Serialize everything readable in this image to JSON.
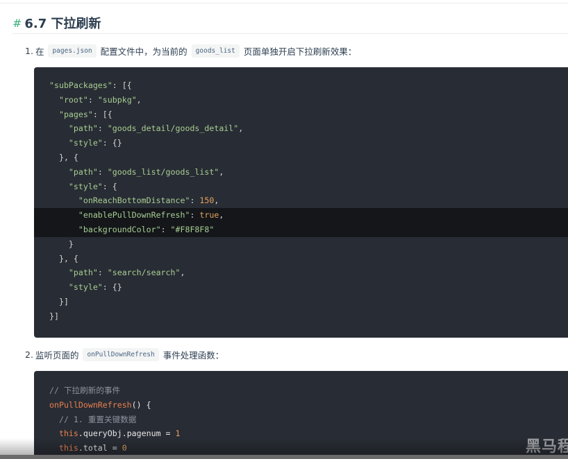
{
  "section": {
    "hash": "#",
    "title": "6.7 下拉刷新"
  },
  "steps": [
    {
      "num": "1.",
      "text_before": "在",
      "code1": "pages.json",
      "text_middle": "配置文件中，为当前的",
      "code2": "goods_list",
      "text_after": "页面单独开启下拉刷新效果："
    },
    {
      "num": "2.",
      "text_before": "监听页面的",
      "code1": "onPullDownRefresh",
      "text_after": "事件处理函数："
    }
  ],
  "code_block_1": {
    "lines": [
      "\"subPackages\": [{",
      "  \"root\": \"subpkg\",",
      "  \"pages\": [{",
      "    \"path\": \"goods_detail/goods_detail\",",
      "    \"style\": {}",
      "  }, {",
      "    \"path\": \"goods_list/goods_list\",",
      "    \"style\": {",
      "      \"onReachBottomDistance\": 150,",
      "      \"enablePullDownRefresh\": true,",
      "      \"backgroundColor\": \"#F8F8F8\"",
      "    }",
      "  }, {",
      "    \"path\": \"search/search\",",
      "    \"style\": {}",
      "  }]",
      "}]"
    ],
    "highlighted_lines": [
      9,
      10
    ]
  },
  "code_block_2": {
    "lines": [
      "// 下拉刷新的事件",
      "onPullDownRefresh() {",
      "  // 1. 重置关键数据",
      "  this.queryObj.pagenum = 1",
      "  this.total = 0"
    ]
  },
  "watermark": "黑马程",
  "colors": {
    "accent": "#3eaf7c",
    "code_bg": "#282c34",
    "highlight_bg": "#14161a",
    "string": "#a8ce93",
    "number": "#e2a35c",
    "comment": "#8d949e"
  }
}
